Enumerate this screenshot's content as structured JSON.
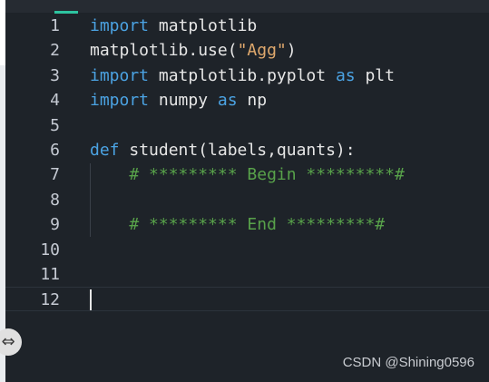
{
  "editor": {
    "lines": [
      {
        "number": "1",
        "tokens": [
          [
            "kw",
            "import"
          ],
          [
            "plain",
            " matplotlib"
          ]
        ]
      },
      {
        "number": "2",
        "tokens": [
          [
            "plain",
            "matplotlib.use("
          ],
          [
            "str",
            "\"Agg\""
          ],
          [
            "plain",
            ")"
          ]
        ]
      },
      {
        "number": "3",
        "tokens": [
          [
            "kw",
            "import"
          ],
          [
            "plain",
            " matplotlib.pyplot "
          ],
          [
            "kw",
            "as"
          ],
          [
            "plain",
            " plt"
          ]
        ]
      },
      {
        "number": "4",
        "tokens": [
          [
            "kw",
            "import"
          ],
          [
            "plain",
            " numpy "
          ],
          [
            "kw",
            "as"
          ],
          [
            "plain",
            " np"
          ]
        ]
      },
      {
        "number": "5",
        "tokens": []
      },
      {
        "number": "6",
        "tokens": [
          [
            "kw",
            "def"
          ],
          [
            "plain",
            " student(labels,quants):"
          ]
        ]
      },
      {
        "number": "7",
        "tokens": [
          [
            "plain",
            "    "
          ],
          [
            "cm",
            "# ********* Begin *********#"
          ]
        ]
      },
      {
        "number": "8",
        "tokens": []
      },
      {
        "number": "9",
        "tokens": [
          [
            "plain",
            "    "
          ],
          [
            "cm",
            "# ********* End *********#"
          ]
        ]
      },
      {
        "number": "10",
        "tokens": []
      },
      {
        "number": "11",
        "tokens": []
      },
      {
        "number": "12",
        "tokens": []
      }
    ],
    "current_line": "12"
  },
  "resize_handle": {
    "icon": "swap-arrows-icon",
    "glyph": "⇔"
  },
  "watermark": "CSDN @Shining0596",
  "colors": {
    "background": "#1e2329",
    "keyword": "#4ba3e3",
    "string": "#e0a96d",
    "comment": "#58a24a",
    "text": "#e6e6e6",
    "accent": "#2ec4a0"
  }
}
